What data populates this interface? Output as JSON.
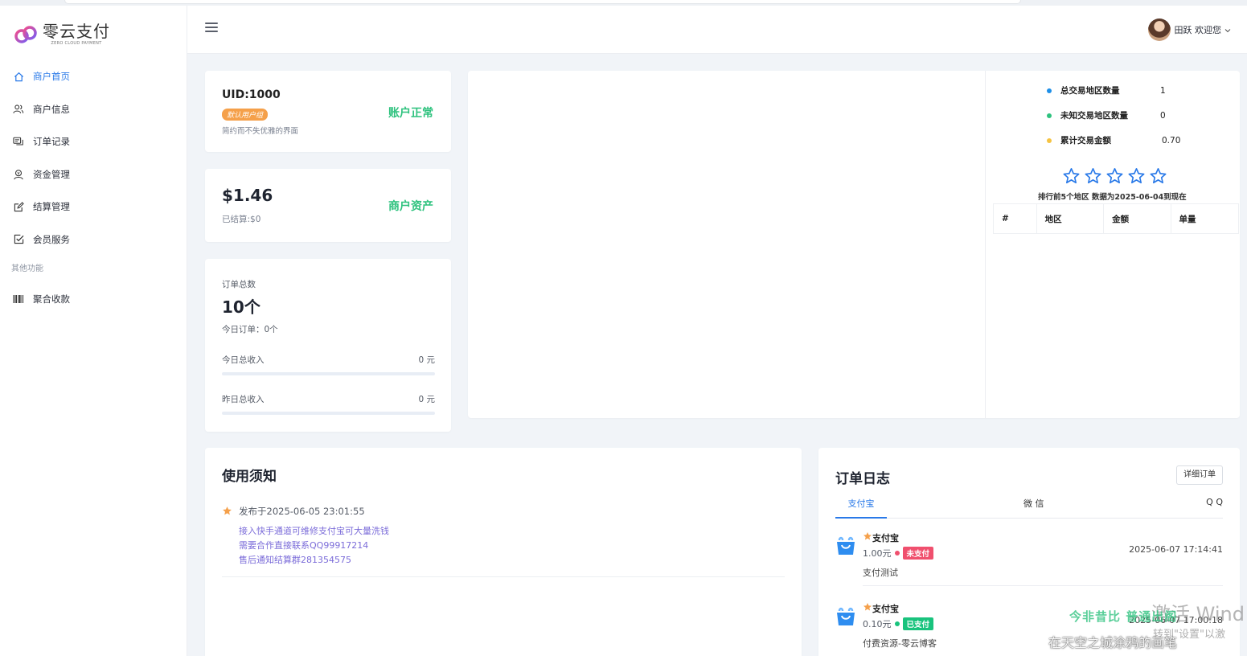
{
  "app": {
    "brand_title": "零云支付",
    "brand_sub": "ZERO CLOUD PAYMENT",
    "accent_color": "#2979e8"
  },
  "sidebar": {
    "items": [
      {
        "label": "商户首页",
        "icon": "home-icon",
        "active": true
      },
      {
        "label": "商户信息",
        "icon": "users-icon",
        "active": false
      },
      {
        "label": "订单记录",
        "icon": "chat-list-icon",
        "active": false
      },
      {
        "label": "资金管理",
        "icon": "user-money-icon",
        "active": false
      },
      {
        "label": "结算管理",
        "icon": "edit-icon",
        "active": false
      },
      {
        "label": "会员服务",
        "icon": "checkbox-icon",
        "active": false
      }
    ],
    "section_label": "其他功能",
    "extra_items": [
      {
        "label": "聚合收款",
        "icon": "barcode-icon"
      }
    ]
  },
  "header": {
    "user_greeting": "田跃 欢迎您"
  },
  "account_card": {
    "uid": "UID:1000",
    "group_badge": "默认用户组",
    "slogan": "简约而不失优雅的界面",
    "status": "账户正常"
  },
  "asset_card": {
    "amount": "$1.46",
    "settled": "已结算:$0",
    "label": "商户资产"
  },
  "orders_card": {
    "total_label": "订单总数",
    "total_value": "10个",
    "today_orders": "今日订单：0个",
    "today_income_label": "今日总收入",
    "today_income_value": "0 元",
    "yesterday_income_label": "昨日总收入",
    "yesterday_income_value": "0 元"
  },
  "region_stats": {
    "rows": [
      {
        "label": "总交易地区数量",
        "value": "1",
        "color": "#1e8fe8"
      },
      {
        "label": "未知交易地区数量",
        "value": "0",
        "color": "#2ec27e"
      },
      {
        "label": "累计交易金额",
        "value": "0.70",
        "color": "#f5c342"
      }
    ],
    "star_count": 5,
    "rank_caption": "排行前5个地区  数据为2025-06-04到现在",
    "table_headers": [
      "#",
      "地区",
      "金额",
      "单量"
    ]
  },
  "notice": {
    "title": "使用须知",
    "date": "发布于2025-06-05 23:01:55",
    "lines": [
      "接入快手通道可维修支付宝可大量洗钱",
      "需要合作直接联系QQ99917214",
      "售后通知结算群281354575"
    ]
  },
  "order_log": {
    "title": "订单日志",
    "detail_button": "详细订单",
    "tabs": [
      "支付宝",
      "微 信",
      "Q Q"
    ],
    "entries": [
      {
        "channel": "支付宝",
        "amount": "1.00元",
        "status": "未支付",
        "status_color": "#f0506e",
        "time": "2025-06-07 17:14:41",
        "desc": "支付测试"
      },
      {
        "channel": "支付宝",
        "amount": "0.10元",
        "status": "已支付",
        "status_color": "#19c37d",
        "time": "2025-06-07 17:00:18",
        "desc": "付费资源-零云博客"
      }
    ]
  },
  "overlay": {
    "windows_activate": "激活 Wind",
    "windows_hint": "转到\"设置\"以激",
    "green_caption": "今非昔比   普通出阁",
    "caption_line": "在天空之城涂鸦的画笔"
  }
}
